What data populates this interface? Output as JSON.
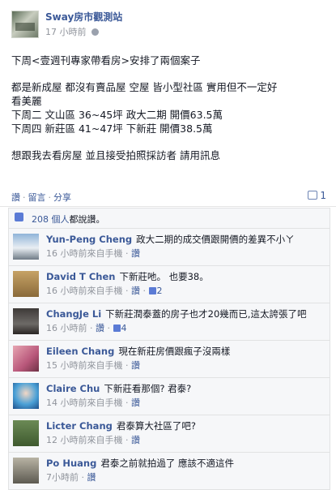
{
  "post": {
    "page_name": "Sway房市觀測站",
    "time": "17 小時前",
    "lines": [
      "下周<壹週刊專家帶看房>安排了兩個案子",
      "",
      "都是新成屋 都沒有賣品屋 空屋 皆小型社區 實用但不一定好",
      "看美麗",
      "下周二 文山區 36~45坪 政大二期 開價63.5萬",
      "下周四 新莊區 41~47坪 下新莊 開價38.5萬",
      "",
      "想跟我去看房屋 並且接受拍照採訪者 請用訊息"
    ]
  },
  "actions": {
    "like": "讚",
    "comment": "留言",
    "share": "分享",
    "share_count": "1"
  },
  "likes": {
    "count_text": "208 個人",
    "suffix": "都說讚。"
  },
  "comments": [
    {
      "author": "Yun-Peng Cheng",
      "text": "政大二期的成交價跟開價的差異不小ㄚ",
      "time": "16 小時前來自手機",
      "like": "讚",
      "likes": ""
    },
    {
      "author": "David T Chen",
      "text": "下新莊吔。 也要38。",
      "time": "16 小時前來自手機",
      "like": "讚",
      "likes": "2"
    },
    {
      "author": "ChangJe Li",
      "text": "下新莊潤泰蓋的房子也才20幾而已,這太誇張了吧",
      "time": "16 小時前",
      "like": "讚",
      "likes": "4"
    },
    {
      "author": "Eileen Chang",
      "text": "現在新莊房價跟瘋子沒兩樣",
      "time": "15 小時前來自手機",
      "like": "讚",
      "likes": ""
    },
    {
      "author": "Claire Chu",
      "text": "下新莊看那個? 君泰?",
      "time": "14 小時前來自手機",
      "like": "讚",
      "likes": ""
    },
    {
      "author": "Licter Chang",
      "text": "君泰算大社區了吧?",
      "time": "12 小時前來自手機",
      "like": "讚",
      "likes": ""
    },
    {
      "author": "Po Huang",
      "text": "君泰之前就拍過了 應該不適這件",
      "time": "7小時前",
      "like": "讚",
      "likes": ""
    }
  ]
}
